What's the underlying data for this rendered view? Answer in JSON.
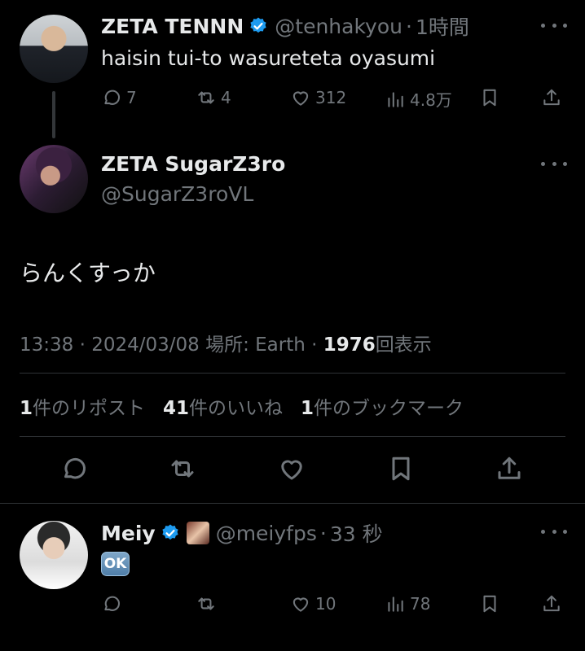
{
  "tweets": [
    {
      "name": "ZETA TENNN",
      "handle": "@tenhakyou",
      "time": "1時間",
      "text": "haisin tui-to wasureteta oyasumi",
      "replies": "7",
      "reposts": "4",
      "likes": "312",
      "views": "4.8万"
    }
  ],
  "main": {
    "name": "ZETA SugarZ3ro",
    "handle": "@SugarZ3roVL",
    "text": "らんくすっか",
    "meta_time": "13:38 · 2024/03/08 場所: Earth · ",
    "views_count": "1976",
    "views_label": "回表示",
    "reposts_count": "1",
    "reposts_label": "件のリポスト",
    "likes_count": "41",
    "likes_label": "件のいいね",
    "bookmarks_count": "1",
    "bookmarks_label": "件のブックマーク"
  },
  "reply": {
    "name": "Meiy",
    "handle": "@meiyfps",
    "time": "33 秒",
    "text": "OK",
    "reposts": "",
    "likes": "10",
    "views": "78"
  },
  "separator": "·",
  "colors": {
    "background": "#000000",
    "text": "#e7e9ea",
    "muted": "#71767b",
    "verified": "#1d9bf0",
    "divider": "#2f3336"
  },
  "icons": [
    "reply-icon",
    "repost-icon",
    "like-icon",
    "views-icon",
    "bookmark-icon",
    "share-icon",
    "verified-icon",
    "more-icon"
  ]
}
